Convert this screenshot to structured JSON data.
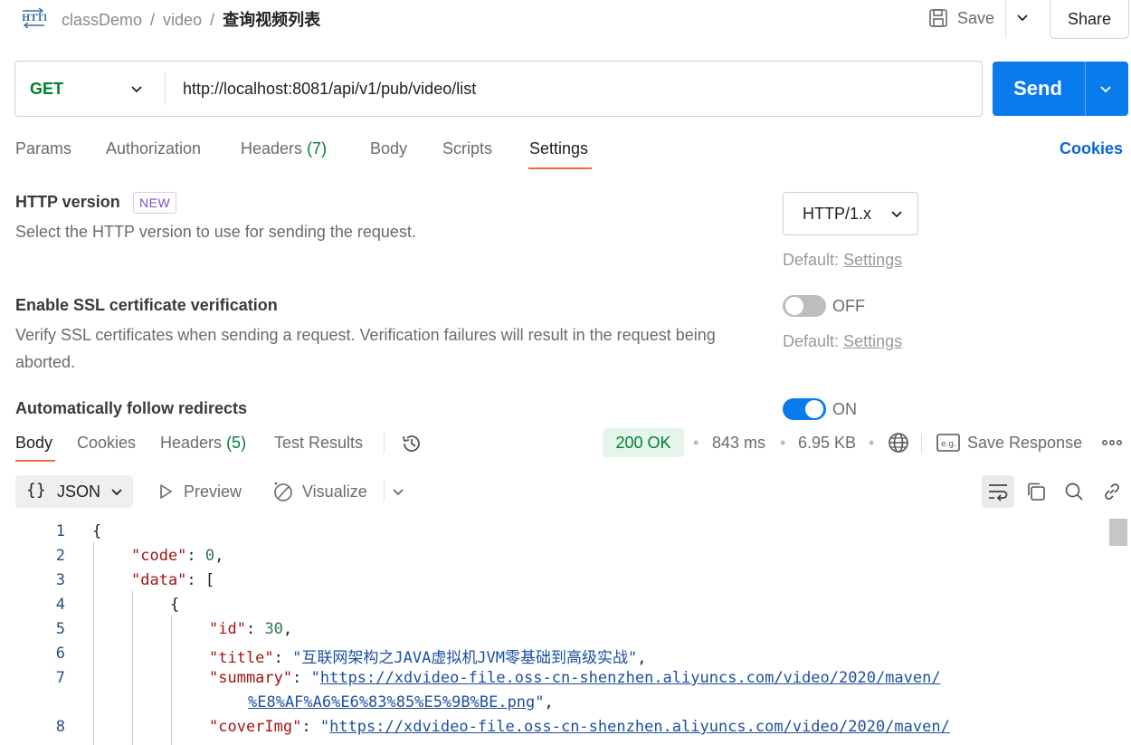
{
  "header": {
    "breadcrumbs": [
      "classDemo",
      "video"
    ],
    "separator": "/",
    "current": "查询视频列表",
    "save_label": "Save",
    "share_label": "Share"
  },
  "request": {
    "method": "GET",
    "url": "http://localhost:8081/api/v1/pub/video/list",
    "send_label": "Send"
  },
  "tabs": {
    "params": "Params",
    "authorization": "Authorization",
    "headers": "Headers",
    "headers_count": "(7)",
    "body": "Body",
    "scripts": "Scripts",
    "settings": "Settings",
    "cookies": "Cookies"
  },
  "settings": {
    "http_version": {
      "title": "HTTP version",
      "badge": "NEW",
      "desc": "Select the HTTP version to use for sending the request.",
      "value": "HTTP/1.x",
      "default_prefix": "Default:",
      "default_link": "Settings"
    },
    "ssl": {
      "title": "Enable SSL certificate verification",
      "desc": "Verify SSL certificates when sending a request. Verification failures will result in the request being aborted.",
      "state": "OFF",
      "default_prefix": "Default:",
      "default_link": "Settings"
    },
    "redirects": {
      "title": "Automatically follow redirects",
      "state": "ON"
    }
  },
  "response": {
    "tabs": {
      "body": "Body",
      "cookies": "Cookies",
      "headers": "Headers",
      "headers_count": "(5)",
      "test_results": "Test Results"
    },
    "status": "200 OK",
    "time": "843 ms",
    "size": "6.95 KB",
    "save_response": "Save Response",
    "format": "JSON",
    "braces": "{}",
    "preview": "Preview",
    "visualize": "Visualize"
  },
  "code": {
    "line_numbers": [
      "1",
      "2",
      "3",
      "4",
      "5",
      "6",
      "7",
      "8"
    ],
    "open_brace": "{",
    "code_key": "\"code\"",
    "code_value": "0",
    "data_key": "\"data\"",
    "open_bracket": "[",
    "id_key": "\"id\"",
    "id_value": "30",
    "title_key": "\"title\"",
    "title_value": "\"互联网架构之JAVA虚拟机JVM零基础到高级实战\"",
    "summary_key": "\"summary\"",
    "summary_url_1": "https://xdvideo-file.oss-cn-shenzhen.aliyuncs.com/video/2020/maven/",
    "summary_url_2": "%E8%AF%A6%E6%83%85%E5%9B%BE.png",
    "cover_key": "\"coverImg\"",
    "cover_url_1": "https://xdvideo-file.oss-cn-shenzhen.aliyuncs.com/video/2020/maven/"
  },
  "colors": {
    "accent": "#097bed",
    "tab_underline": "#f26b3a",
    "success": "#007f31"
  }
}
